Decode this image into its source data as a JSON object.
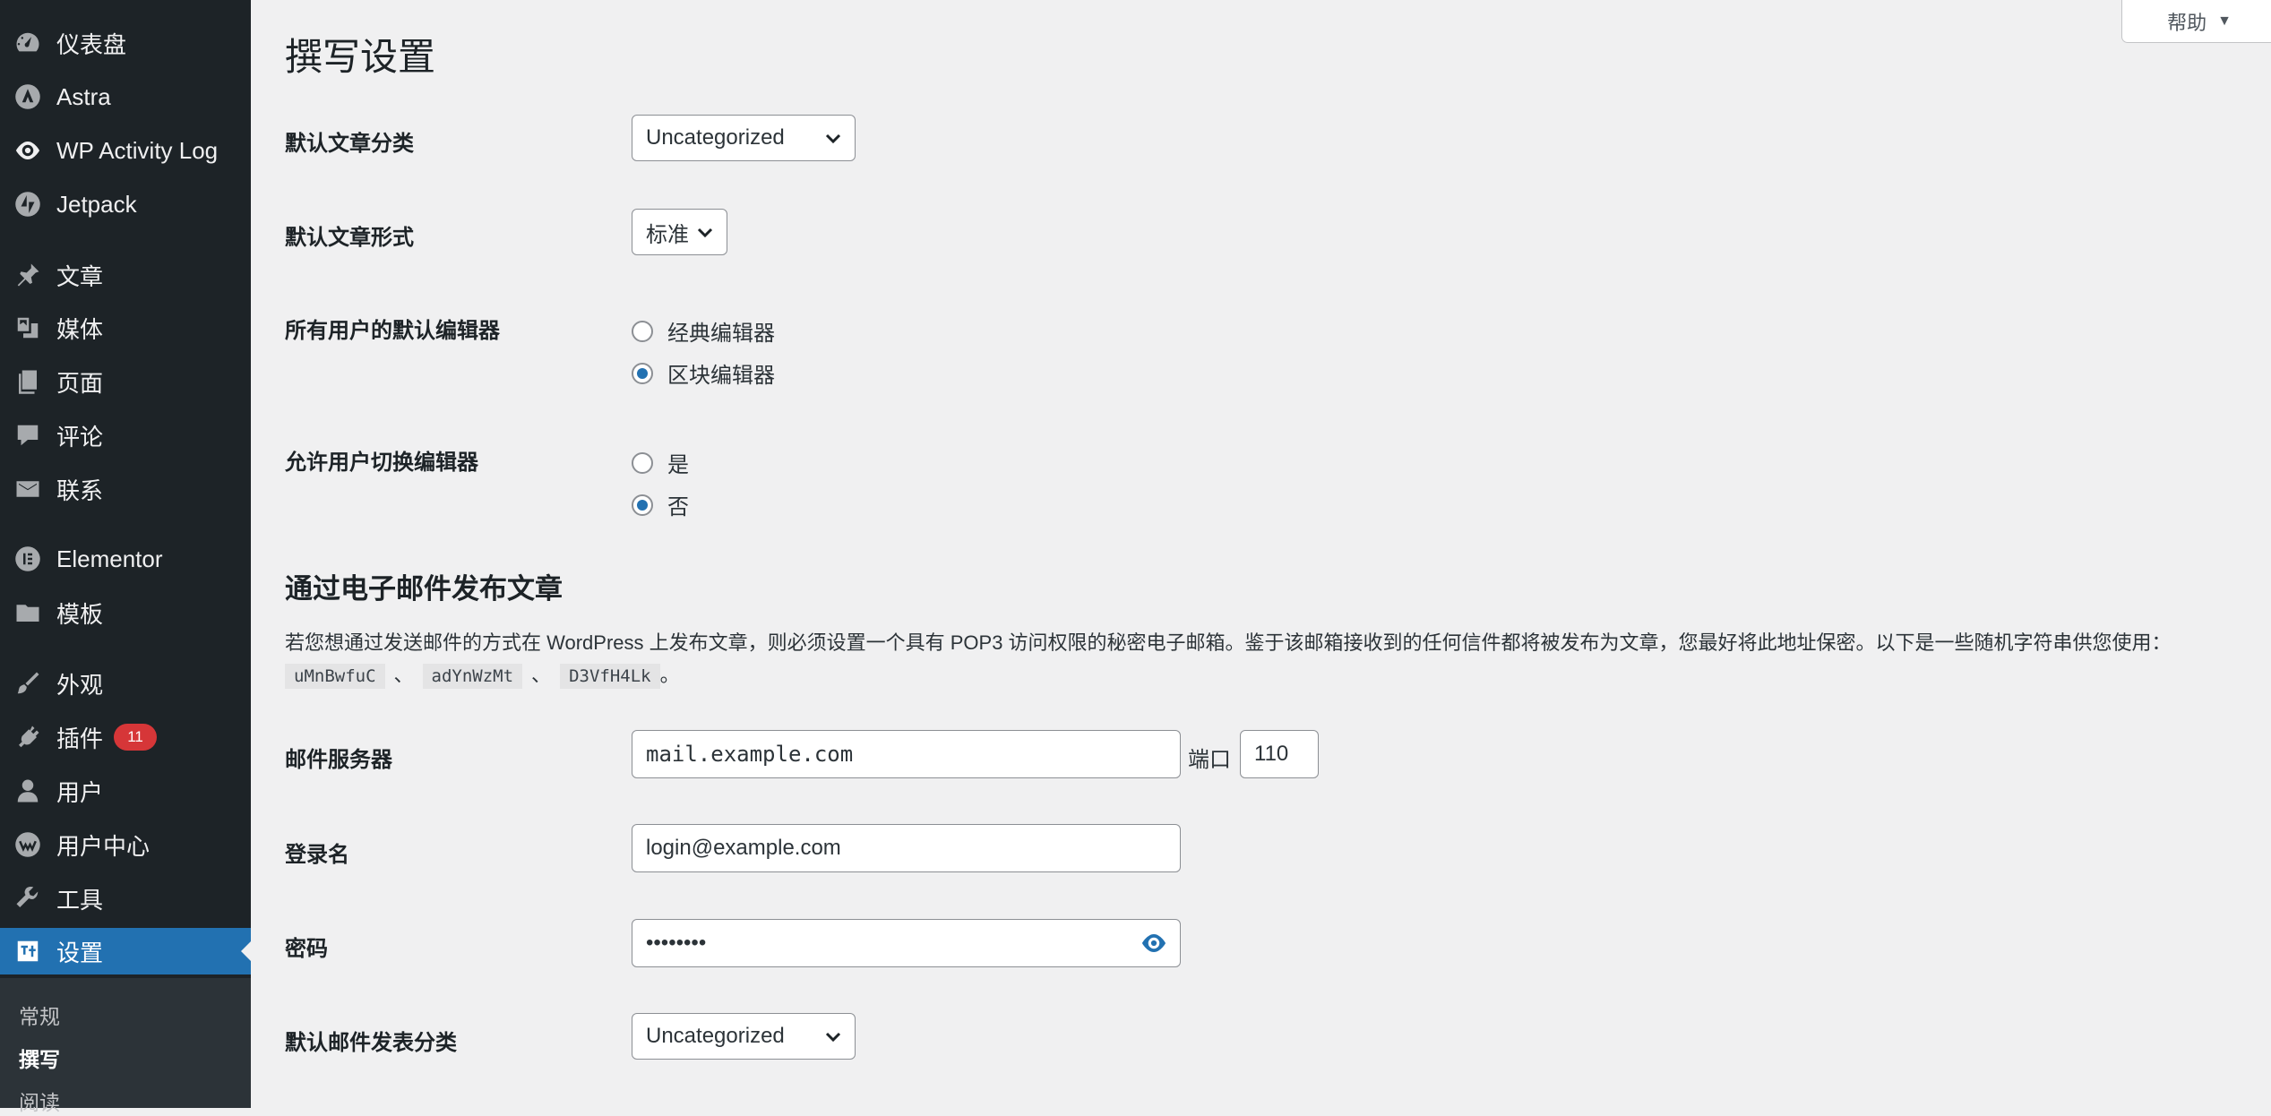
{
  "sidebar": {
    "items": [
      {
        "label": "仪表盘",
        "icon": "dashboard-icon"
      },
      {
        "label": "Astra",
        "icon": "astra-icon"
      },
      {
        "label": "WP Activity Log",
        "icon": "activity-log-icon"
      },
      {
        "label": "Jetpack",
        "icon": "jetpack-icon"
      },
      {
        "label": "文章",
        "icon": "pin-icon"
      },
      {
        "label": "媒体",
        "icon": "media-icon"
      },
      {
        "label": "页面",
        "icon": "page-icon"
      },
      {
        "label": "评论",
        "icon": "comment-icon"
      },
      {
        "label": "联系",
        "icon": "mail-icon"
      },
      {
        "label": "Elementor",
        "icon": "elementor-icon"
      },
      {
        "label": "模板",
        "icon": "folder-icon"
      },
      {
        "label": "外观",
        "icon": "brush-icon"
      },
      {
        "label": "插件",
        "icon": "plugin-icon",
        "badge": "11"
      },
      {
        "label": "用户",
        "icon": "user-icon"
      },
      {
        "label": "用户中心",
        "icon": "user-center-icon"
      },
      {
        "label": "工具",
        "icon": "wrench-icon"
      },
      {
        "label": "设置",
        "icon": "settings-icon",
        "current": true
      }
    ],
    "submenu": [
      "常规",
      "撰写",
      "阅读"
    ]
  },
  "help": {
    "label": "帮助",
    "caret": "▼"
  },
  "page": {
    "title": "撰写设置",
    "default_category": {
      "label": "默认文章分类",
      "value": "Uncategorized"
    },
    "default_format": {
      "label": "默认文章形式",
      "value": "标准"
    },
    "default_editor": {
      "label": "所有用户的默认编辑器",
      "options": [
        "经典编辑器",
        "区块编辑器"
      ],
      "selected": "区块编辑器"
    },
    "allow_switch": {
      "label": "允许用户切换编辑器",
      "options": [
        "是",
        "否"
      ],
      "selected": "否"
    },
    "email_section": {
      "title": "通过电子邮件发布文章",
      "description": "若您想通过发送邮件的方式在 WordPress 上发布文章，则必须设置一个具有 POP3 访问权限的秘密电子邮箱。鉴于该邮箱接收到的任何信件都将被发布为文章，您最好将此地址保密。以下是一些随机字符串供您使用：",
      "random_strings": [
        "uMnBwfuC",
        "adYnWzMt",
        "D3VfH4Lk"
      ],
      "separator": "、",
      "end": "。"
    },
    "mail_server": {
      "label": "邮件服务器",
      "value": "mail.example.com",
      "port_label": "端口",
      "port_value": "110"
    },
    "login_name": {
      "label": "登录名",
      "value": "login@example.com"
    },
    "password": {
      "label": "密码",
      "value": "••••••••"
    },
    "mail_category": {
      "label": "默认邮件发表分类",
      "value": "Uncategorized"
    }
  },
  "colors": {
    "accent": "#2271b1",
    "sidebar_bg": "#1d2327",
    "badge": "#d63638"
  }
}
